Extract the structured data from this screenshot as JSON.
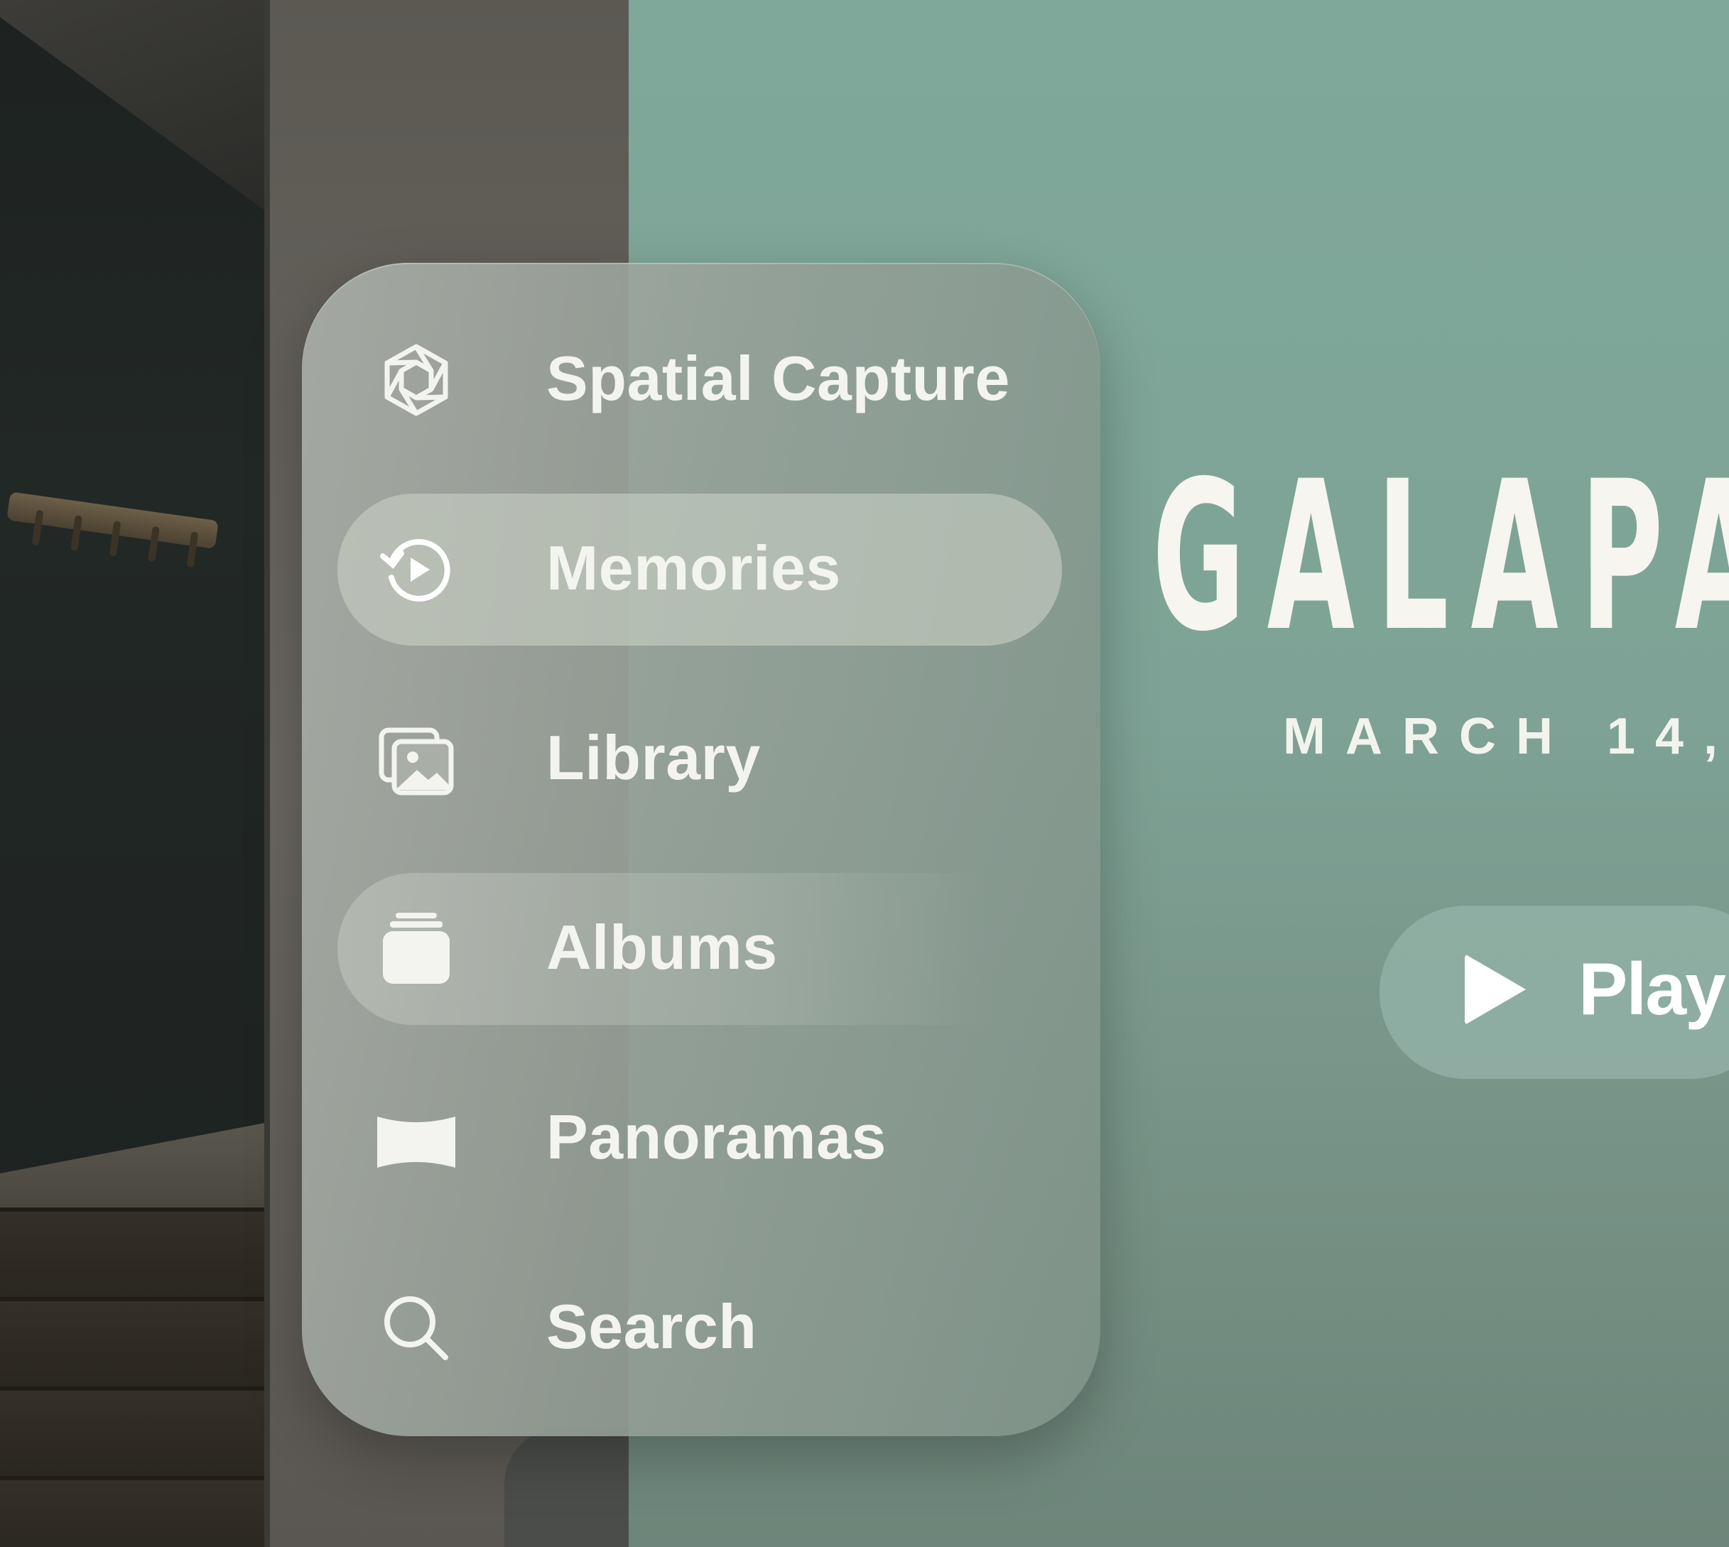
{
  "sidebar": {
    "items": [
      {
        "label": "Spatial Capture",
        "icon": "spatial-capture-icon",
        "state": "default"
      },
      {
        "label": "Memories",
        "icon": "memories-icon",
        "state": "selected"
      },
      {
        "label": "Library",
        "icon": "library-icon",
        "state": "default"
      },
      {
        "label": "Albums",
        "icon": "albums-icon",
        "state": "hovered"
      },
      {
        "label": "Panoramas",
        "icon": "panoramas-icon",
        "state": "default"
      },
      {
        "label": "Search",
        "icon": "search-icon",
        "state": "default"
      }
    ]
  },
  "memory": {
    "title": "GALAPA",
    "date": "MARCH 14,",
    "play_label": "Play"
  },
  "colors": {
    "player_background": "#7fa89a",
    "sidebar_glass": "#9aa39b",
    "text": "#f3f4f0"
  }
}
